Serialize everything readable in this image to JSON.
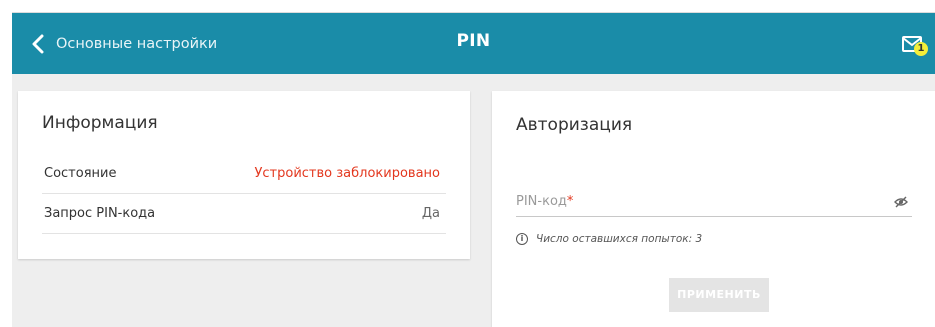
{
  "header": {
    "back_label": "Основные настройки",
    "title": "PIN",
    "notification_count": "1",
    "accent_color": "#1a8ca8"
  },
  "info": {
    "title": "Информация",
    "rows": [
      {
        "label": "Состояние",
        "value": "Устройство заблокировано",
        "value_color": "#e3371e"
      },
      {
        "label": "Запрос PIN-кода",
        "value": "Да"
      }
    ]
  },
  "auth": {
    "title": "Авторизация",
    "pin_placeholder": "PIN-код",
    "required_mark": "*",
    "attempts_hint": "Число оставшихся попыток: 3",
    "apply_label": "ПРИМЕНИТЬ"
  },
  "icons": [
    "chevron-left-icon",
    "envelope-icon",
    "eye-off-icon",
    "info-icon"
  ]
}
